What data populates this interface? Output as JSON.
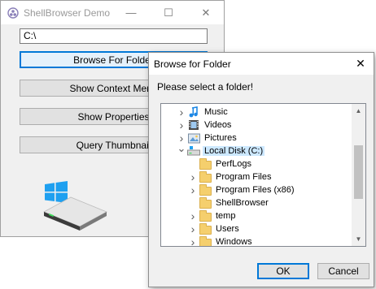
{
  "main_window": {
    "title": "ShellBrowser Demo",
    "path_value": "C:\\",
    "buttons": [
      {
        "label": "Browse For Folder"
      },
      {
        "label": "Show Context Menu"
      },
      {
        "label": "Show Properties"
      },
      {
        "label": "Query Thumbnail"
      }
    ],
    "controls": {
      "minimize": "—",
      "maximize": "☐",
      "close": "✕"
    }
  },
  "dialog": {
    "title": "Browse for Folder",
    "prompt": "Please select a folder!",
    "close_glyph": "✕",
    "tree": [
      {
        "label": "Music",
        "icon": "music-icon",
        "expander": ">"
      },
      {
        "label": "Videos",
        "icon": "videos-icon",
        "expander": ">"
      },
      {
        "label": "Pictures",
        "icon": "pictures-icon",
        "expander": ">"
      },
      {
        "label": "Local Disk (C:)",
        "icon": "drive-icon",
        "expander": "v",
        "selected": true
      },
      {
        "label": "PerfLogs",
        "icon": "folder-icon",
        "expander": ""
      },
      {
        "label": "Program Files",
        "icon": "folder-icon",
        "expander": ">"
      },
      {
        "label": "Program Files (x86)",
        "icon": "folder-icon",
        "expander": ">"
      },
      {
        "label": "ShellBrowser",
        "icon": "folder-icon",
        "expander": ""
      },
      {
        "label": "temp",
        "icon": "folder-icon",
        "expander": ">"
      },
      {
        "label": "Users",
        "icon": "folder-icon",
        "expander": ">"
      },
      {
        "label": "Windows",
        "icon": "folder-icon",
        "expander": ">"
      }
    ],
    "scroll_position": 0.45,
    "ok_label": "OK",
    "cancel_label": "Cancel"
  },
  "colors": {
    "accent": "#0078d7",
    "selection": "#cce8ff",
    "folder": "#f5cf6d"
  }
}
